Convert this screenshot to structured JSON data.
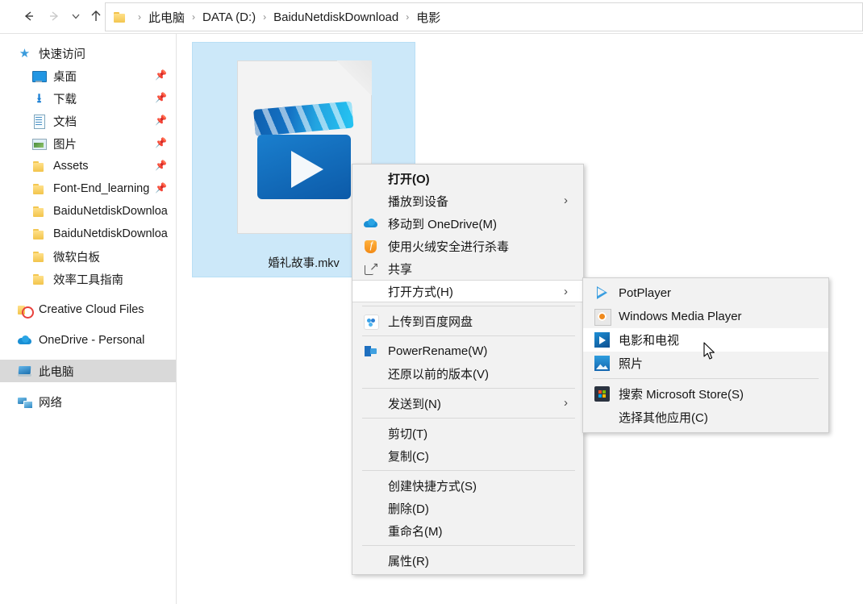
{
  "window": {
    "nav": {
      "back_icon": "arrow-left-icon",
      "forward_icon": "arrow-right-icon",
      "recent_icon": "chevron-down-icon",
      "up_icon": "arrow-up-icon"
    },
    "address_bar": {
      "folder_icon": "folder-icon",
      "separator": "›",
      "crumbs": [
        "此电脑",
        "DATA (D:)",
        "BaiduNetdiskDownload",
        "电影"
      ]
    }
  },
  "sidebar": {
    "quick_access": {
      "label": "快速访问",
      "icon": "star-icon"
    },
    "items": [
      {
        "label": "桌面",
        "icon": "desktop-icon",
        "pinned": true
      },
      {
        "label": "下载",
        "icon": "download-icon",
        "pinned": true
      },
      {
        "label": "文档",
        "icon": "documents-icon",
        "pinned": true
      },
      {
        "label": "图片",
        "icon": "pictures-icon",
        "pinned": true
      },
      {
        "label": "Assets",
        "icon": "folder-icon",
        "pinned": true
      },
      {
        "label": "Font-End_learning",
        "icon": "folder-icon",
        "pinned": true
      },
      {
        "label": "BaiduNetdiskDownloa",
        "icon": "folder-icon",
        "pinned": false
      },
      {
        "label": "BaiduNetdiskDownloa",
        "icon": "folder-icon",
        "pinned": false
      },
      {
        "label": "微软白板",
        "icon": "folder-icon",
        "pinned": false
      },
      {
        "label": "效率工具指南",
        "icon": "folder-icon",
        "pinned": false
      }
    ],
    "roots": [
      {
        "label": "Creative Cloud Files",
        "icon": "creative-cloud-icon",
        "selected": false
      },
      {
        "label": "OneDrive - Personal",
        "icon": "onedrive-icon",
        "selected": false
      },
      {
        "label": "此电脑",
        "icon": "this-pc-icon",
        "selected": true
      },
      {
        "label": "网络",
        "icon": "network-icon",
        "selected": false
      }
    ],
    "pin_icon": "pin-icon"
  },
  "content": {
    "file": {
      "name": "婚礼故事.mkv",
      "icon": "video-file-icon",
      "selected": true
    }
  },
  "context_menu": {
    "items": [
      {
        "label": "打开(O)",
        "bold": true,
        "icon": null,
        "submenu": false,
        "hover": false
      },
      {
        "label": "播放到设备",
        "bold": false,
        "icon": null,
        "submenu": true,
        "hover": false
      },
      {
        "label": "移动到 OneDrive(M)",
        "bold": false,
        "icon": "onedrive-icon",
        "submenu": false,
        "hover": false
      },
      {
        "label": "使用火绒安全进行杀毒",
        "bold": false,
        "icon": "huorong-shield-icon",
        "submenu": false,
        "hover": false
      },
      {
        "label": "共享",
        "bold": false,
        "icon": "share-icon",
        "submenu": false,
        "hover": false
      },
      {
        "label": "打开方式(H)",
        "bold": false,
        "icon": null,
        "submenu": true,
        "hover": true
      },
      {
        "separator": true
      },
      {
        "label": "上传到百度网盘",
        "bold": false,
        "icon": "baidu-netdisk-icon",
        "submenu": false,
        "hover": false
      },
      {
        "separator": true
      },
      {
        "label": "PowerRename(W)",
        "bold": false,
        "icon": "powerrename-icon",
        "submenu": false,
        "hover": false
      },
      {
        "label": "还原以前的版本(V)",
        "bold": false,
        "icon": null,
        "submenu": false,
        "hover": false
      },
      {
        "separator": true
      },
      {
        "label": "发送到(N)",
        "bold": false,
        "icon": null,
        "submenu": true,
        "hover": false
      },
      {
        "separator": true
      },
      {
        "label": "剪切(T)",
        "bold": false,
        "icon": null,
        "submenu": false,
        "hover": false
      },
      {
        "label": "复制(C)",
        "bold": false,
        "icon": null,
        "submenu": false,
        "hover": false
      },
      {
        "separator": true
      },
      {
        "label": "创建快捷方式(S)",
        "bold": false,
        "icon": null,
        "submenu": false,
        "hover": false
      },
      {
        "label": "删除(D)",
        "bold": false,
        "icon": null,
        "submenu": false,
        "hover": false
      },
      {
        "label": "重命名(M)",
        "bold": false,
        "icon": null,
        "submenu": false,
        "hover": false
      },
      {
        "separator": true
      },
      {
        "label": "属性(R)",
        "bold": false,
        "icon": null,
        "submenu": false,
        "hover": false
      }
    ],
    "arrow_glyph": "›"
  },
  "open_with_submenu": {
    "items": [
      {
        "label": "PotPlayer",
        "icon": "potplayer-icon",
        "hover": false
      },
      {
        "label": "Windows Media Player",
        "icon": "windows-media-player-icon",
        "hover": false
      },
      {
        "label": "电影和电视",
        "icon": "movies-and-tv-icon",
        "hover": true
      },
      {
        "label": "照片",
        "icon": "photos-icon",
        "hover": false
      },
      {
        "separator": true
      },
      {
        "label": "搜索 Microsoft Store(S)",
        "icon": "microsoft-store-icon",
        "hover": false
      },
      {
        "label": "选择其他应用(C)",
        "icon": null,
        "hover": false
      }
    ]
  },
  "cursor": {
    "icon": "mouse-pointer-icon"
  },
  "colors": {
    "selection_blue": "#cce8f9",
    "sidebar_selection": "#d9d9d9",
    "menu_background": "#f2f2f2",
    "menu_hover": "#ffffff",
    "accent": "#1a8fd4"
  }
}
